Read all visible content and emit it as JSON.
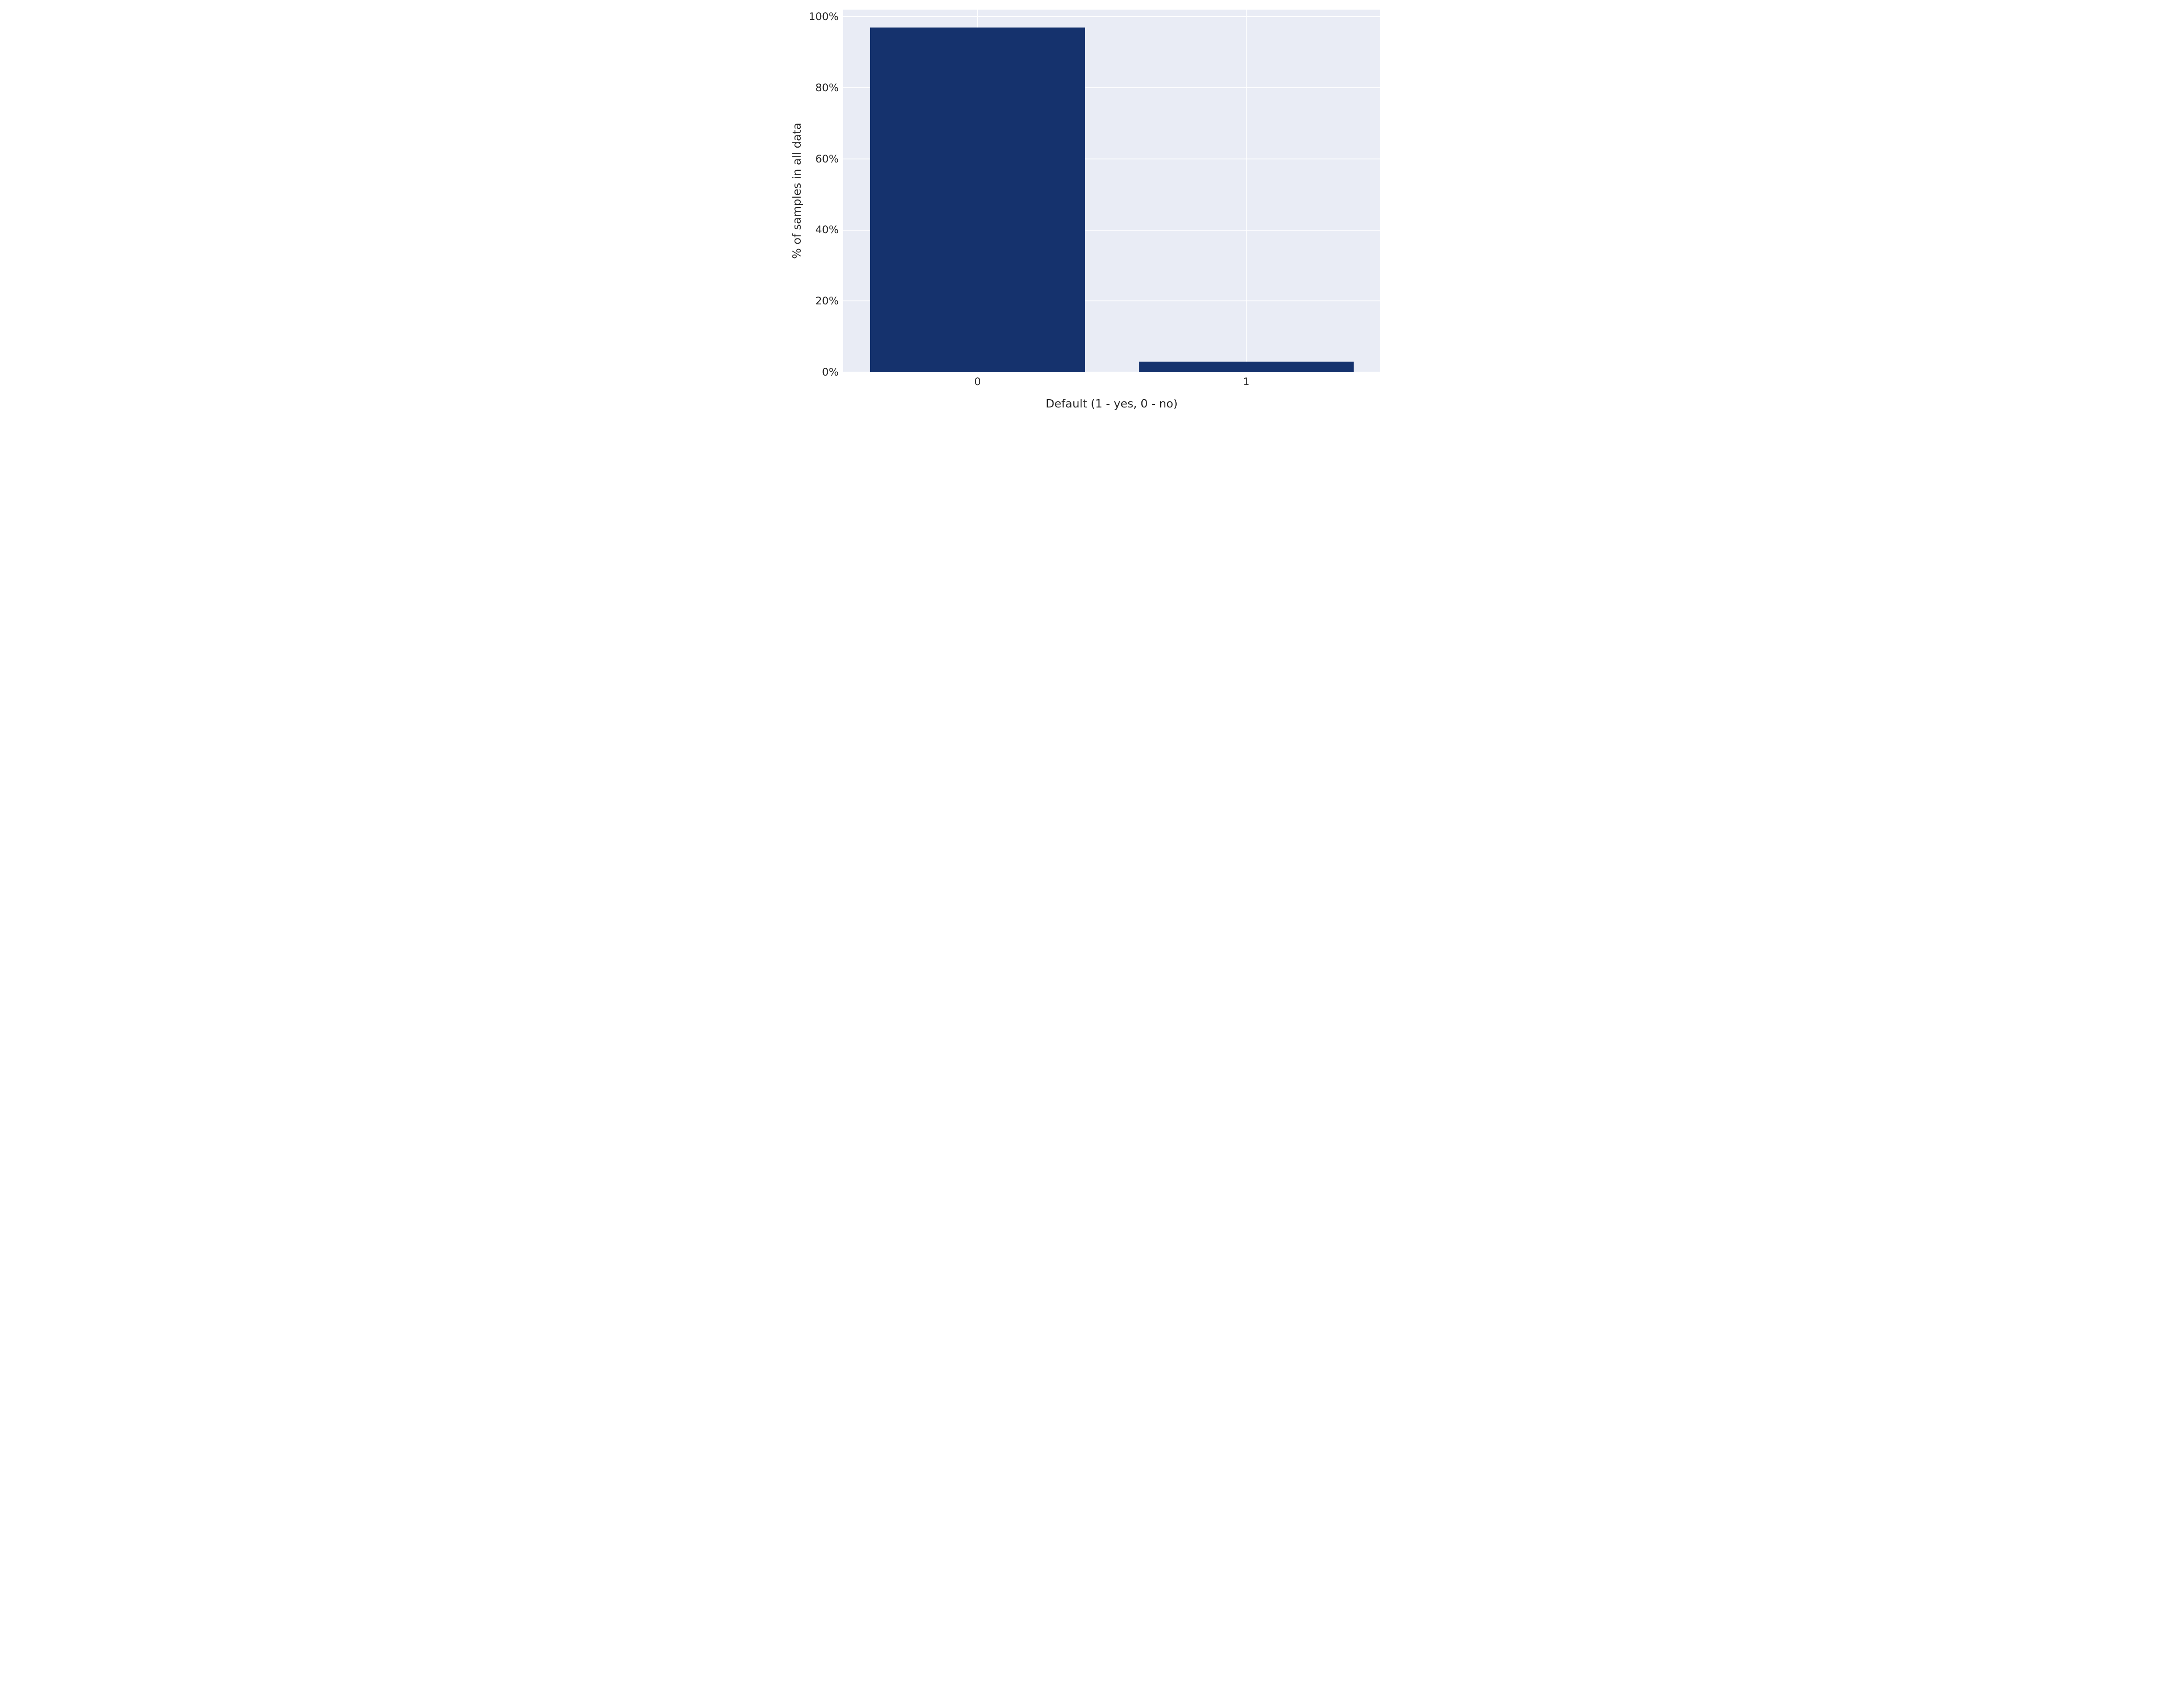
{
  "chart_data": {
    "type": "bar",
    "categories": [
      "0",
      "1"
    ],
    "values": [
      97,
      3
    ],
    "xlabel": "Default (1 - yes, 0 - no)",
    "ylabel": "% of samples in all data",
    "ylim": [
      0,
      102
    ],
    "yticks": [
      0,
      20,
      40,
      60,
      80,
      100
    ],
    "ytick_labels": [
      "0%",
      "20%",
      "40%",
      "60%",
      "80%",
      "100%"
    ],
    "bar_color": "#15326d",
    "plot_bg": "#e9ecf5",
    "grid_color": "#ffffff"
  }
}
